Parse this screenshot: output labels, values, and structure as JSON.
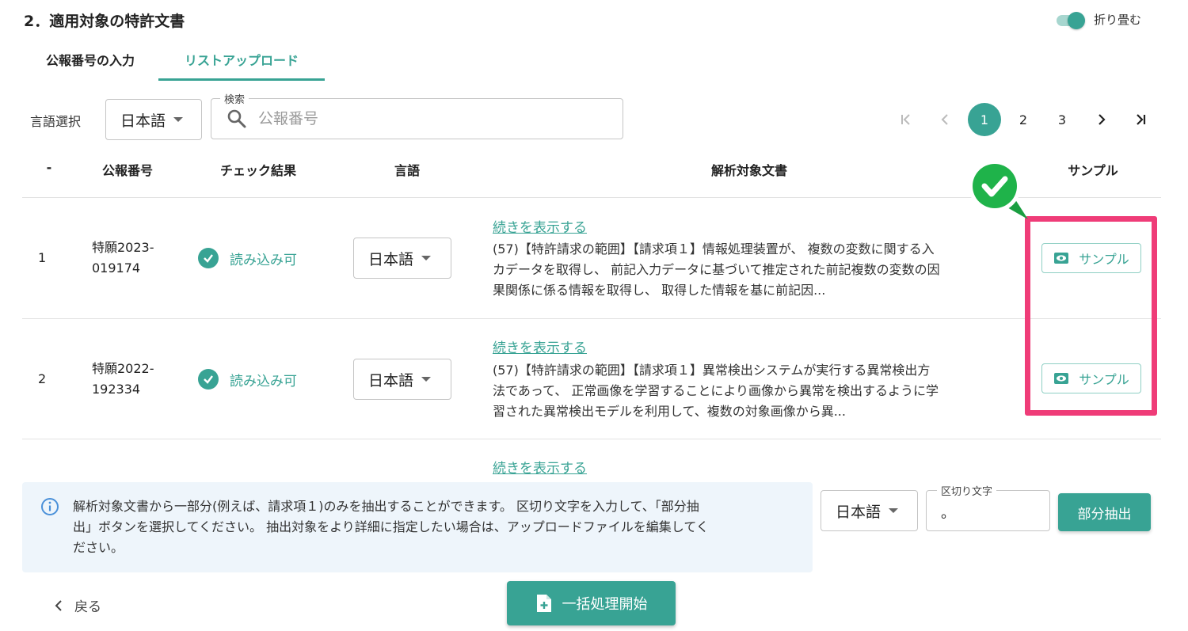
{
  "header": {
    "section_title": "2．適用対象の特許文書",
    "toggle_label": "折り畳む",
    "toggle_on": true
  },
  "tabs": [
    {
      "label": "公報番号の入力",
      "active": false
    },
    {
      "label": "リストアップロード",
      "active": true
    }
  ],
  "filters": {
    "language_label": "言語選択",
    "language_value": "日本語",
    "search_label": "検索",
    "search_placeholder": "公報番号"
  },
  "pagination": {
    "pages": [
      "1",
      "2",
      "3"
    ],
    "current": "1"
  },
  "table": {
    "headers": [
      "-",
      "公報番号",
      "チェック結果",
      "言語",
      "解析対象文書",
      "サンプル"
    ],
    "rows": [
      {
        "no": "1",
        "id_line1": "特願2023-",
        "id_line2": "019174",
        "check": "読み込み可",
        "language": "日本語",
        "show_more": "続きを表示する",
        "excerpt_lines": [
          "(57)【特許請求の範囲】【請求項１】情報処理装置が、 複数の変数に関する入",
          "カデータを取得し、 前記入力データに基づいて推定された前記複数の変数の因",
          "果関係に係る情報を取得し、 取得した情報を基に前記因..."
        ],
        "sample_label": "サンプル"
      },
      {
        "no": "2",
        "id_line1": "特願2022-",
        "id_line2": "192334",
        "check": "読み込み可",
        "language": "日本語",
        "show_more": "続きを表示する",
        "excerpt_lines": [
          "(57)【特許請求の範囲】【請求項１】異常検出システムが実行する異常検出方",
          "法であって、 正常画像を学習することにより画像から異常を検出するように学",
          "習された異常検出モデルを利用して、複数の対象画像から異..."
        ],
        "sample_label": "サンプル"
      }
    ],
    "partial_row_show_more": "続きを表示する"
  },
  "info": {
    "lines": [
      "解析対象文書から一部分(例えば、請求項１)のみを抽出することができます。 区切り文字を入力して、「部分抽",
      "出」ボタンを選択してください。 抽出対象をより詳細に指定したい場合は、アップロードファイルを編集してく",
      "ださい。"
    ]
  },
  "extract": {
    "language_value": "日本語",
    "delimiter_label": "区切り文字",
    "delimiter_value": "。",
    "button_label": "部分抽出"
  },
  "footer": {
    "back_label": "戻る",
    "start_label": "一括処理開始"
  },
  "colors": {
    "accent": "#38a394",
    "highlight": "#ef3c78",
    "badge": "#1fb34a"
  },
  "icons": [
    "search-icon",
    "first-page-icon",
    "prev-page-icon",
    "next-page-icon",
    "last-page-icon",
    "check-circle-icon",
    "eye-icon",
    "info-icon",
    "chevron-left-icon",
    "file-plus-icon",
    "check-badge-icon"
  ]
}
